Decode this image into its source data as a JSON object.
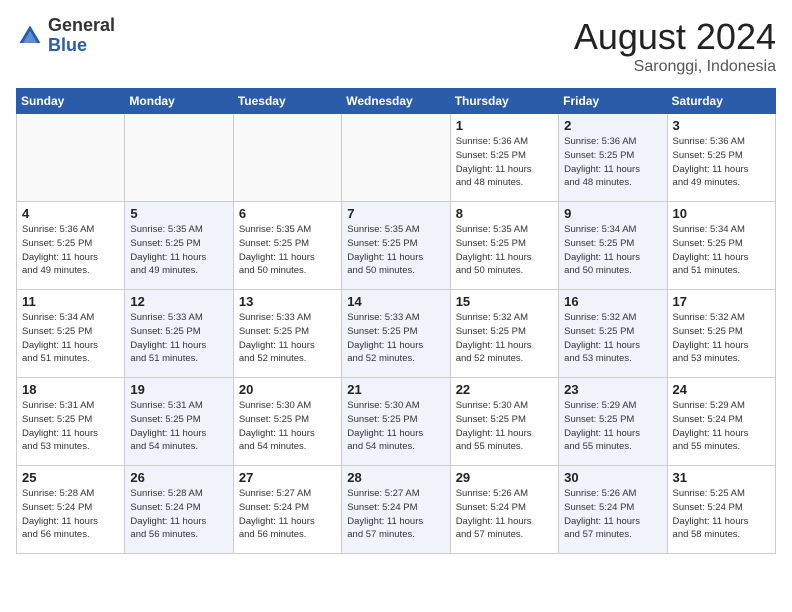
{
  "header": {
    "logo_general": "General",
    "logo_blue": "Blue",
    "title": "August 2024",
    "location": "Saronggi, Indonesia"
  },
  "days_of_week": [
    "Sunday",
    "Monday",
    "Tuesday",
    "Wednesday",
    "Thursday",
    "Friday",
    "Saturday"
  ],
  "weeks": [
    [
      {
        "day": "",
        "info": "",
        "shaded": false,
        "empty": true
      },
      {
        "day": "",
        "info": "",
        "shaded": false,
        "empty": true
      },
      {
        "day": "",
        "info": "",
        "shaded": false,
        "empty": true
      },
      {
        "day": "",
        "info": "",
        "shaded": false,
        "empty": true
      },
      {
        "day": "1",
        "info": "Sunrise: 5:36 AM\nSunset: 5:25 PM\nDaylight: 11 hours\nand 48 minutes.",
        "shaded": false,
        "empty": false
      },
      {
        "day": "2",
        "info": "Sunrise: 5:36 AM\nSunset: 5:25 PM\nDaylight: 11 hours\nand 48 minutes.",
        "shaded": true,
        "empty": false
      },
      {
        "day": "3",
        "info": "Sunrise: 5:36 AM\nSunset: 5:25 PM\nDaylight: 11 hours\nand 49 minutes.",
        "shaded": false,
        "empty": false
      }
    ],
    [
      {
        "day": "4",
        "info": "Sunrise: 5:36 AM\nSunset: 5:25 PM\nDaylight: 11 hours\nand 49 minutes.",
        "shaded": false,
        "empty": false
      },
      {
        "day": "5",
        "info": "Sunrise: 5:35 AM\nSunset: 5:25 PM\nDaylight: 11 hours\nand 49 minutes.",
        "shaded": true,
        "empty": false
      },
      {
        "day": "6",
        "info": "Sunrise: 5:35 AM\nSunset: 5:25 PM\nDaylight: 11 hours\nand 50 minutes.",
        "shaded": false,
        "empty": false
      },
      {
        "day": "7",
        "info": "Sunrise: 5:35 AM\nSunset: 5:25 PM\nDaylight: 11 hours\nand 50 minutes.",
        "shaded": true,
        "empty": false
      },
      {
        "day": "8",
        "info": "Sunrise: 5:35 AM\nSunset: 5:25 PM\nDaylight: 11 hours\nand 50 minutes.",
        "shaded": false,
        "empty": false
      },
      {
        "day": "9",
        "info": "Sunrise: 5:34 AM\nSunset: 5:25 PM\nDaylight: 11 hours\nand 50 minutes.",
        "shaded": true,
        "empty": false
      },
      {
        "day": "10",
        "info": "Sunrise: 5:34 AM\nSunset: 5:25 PM\nDaylight: 11 hours\nand 51 minutes.",
        "shaded": false,
        "empty": false
      }
    ],
    [
      {
        "day": "11",
        "info": "Sunrise: 5:34 AM\nSunset: 5:25 PM\nDaylight: 11 hours\nand 51 minutes.",
        "shaded": false,
        "empty": false
      },
      {
        "day": "12",
        "info": "Sunrise: 5:33 AM\nSunset: 5:25 PM\nDaylight: 11 hours\nand 51 minutes.",
        "shaded": true,
        "empty": false
      },
      {
        "day": "13",
        "info": "Sunrise: 5:33 AM\nSunset: 5:25 PM\nDaylight: 11 hours\nand 52 minutes.",
        "shaded": false,
        "empty": false
      },
      {
        "day": "14",
        "info": "Sunrise: 5:33 AM\nSunset: 5:25 PM\nDaylight: 11 hours\nand 52 minutes.",
        "shaded": true,
        "empty": false
      },
      {
        "day": "15",
        "info": "Sunrise: 5:32 AM\nSunset: 5:25 PM\nDaylight: 11 hours\nand 52 minutes.",
        "shaded": false,
        "empty": false
      },
      {
        "day": "16",
        "info": "Sunrise: 5:32 AM\nSunset: 5:25 PM\nDaylight: 11 hours\nand 53 minutes.",
        "shaded": true,
        "empty": false
      },
      {
        "day": "17",
        "info": "Sunrise: 5:32 AM\nSunset: 5:25 PM\nDaylight: 11 hours\nand 53 minutes.",
        "shaded": false,
        "empty": false
      }
    ],
    [
      {
        "day": "18",
        "info": "Sunrise: 5:31 AM\nSunset: 5:25 PM\nDaylight: 11 hours\nand 53 minutes.",
        "shaded": false,
        "empty": false
      },
      {
        "day": "19",
        "info": "Sunrise: 5:31 AM\nSunset: 5:25 PM\nDaylight: 11 hours\nand 54 minutes.",
        "shaded": true,
        "empty": false
      },
      {
        "day": "20",
        "info": "Sunrise: 5:30 AM\nSunset: 5:25 PM\nDaylight: 11 hours\nand 54 minutes.",
        "shaded": false,
        "empty": false
      },
      {
        "day": "21",
        "info": "Sunrise: 5:30 AM\nSunset: 5:25 PM\nDaylight: 11 hours\nand 54 minutes.",
        "shaded": true,
        "empty": false
      },
      {
        "day": "22",
        "info": "Sunrise: 5:30 AM\nSunset: 5:25 PM\nDaylight: 11 hours\nand 55 minutes.",
        "shaded": false,
        "empty": false
      },
      {
        "day": "23",
        "info": "Sunrise: 5:29 AM\nSunset: 5:25 PM\nDaylight: 11 hours\nand 55 minutes.",
        "shaded": true,
        "empty": false
      },
      {
        "day": "24",
        "info": "Sunrise: 5:29 AM\nSunset: 5:24 PM\nDaylight: 11 hours\nand 55 minutes.",
        "shaded": false,
        "empty": false
      }
    ],
    [
      {
        "day": "25",
        "info": "Sunrise: 5:28 AM\nSunset: 5:24 PM\nDaylight: 11 hours\nand 56 minutes.",
        "shaded": false,
        "empty": false
      },
      {
        "day": "26",
        "info": "Sunrise: 5:28 AM\nSunset: 5:24 PM\nDaylight: 11 hours\nand 56 minutes.",
        "shaded": true,
        "empty": false
      },
      {
        "day": "27",
        "info": "Sunrise: 5:27 AM\nSunset: 5:24 PM\nDaylight: 11 hours\nand 56 minutes.",
        "shaded": false,
        "empty": false
      },
      {
        "day": "28",
        "info": "Sunrise: 5:27 AM\nSunset: 5:24 PM\nDaylight: 11 hours\nand 57 minutes.",
        "shaded": true,
        "empty": false
      },
      {
        "day": "29",
        "info": "Sunrise: 5:26 AM\nSunset: 5:24 PM\nDaylight: 11 hours\nand 57 minutes.",
        "shaded": false,
        "empty": false
      },
      {
        "day": "30",
        "info": "Sunrise: 5:26 AM\nSunset: 5:24 PM\nDaylight: 11 hours\nand 57 minutes.",
        "shaded": true,
        "empty": false
      },
      {
        "day": "31",
        "info": "Sunrise: 5:25 AM\nSunset: 5:24 PM\nDaylight: 11 hours\nand 58 minutes.",
        "shaded": false,
        "empty": false
      }
    ]
  ]
}
